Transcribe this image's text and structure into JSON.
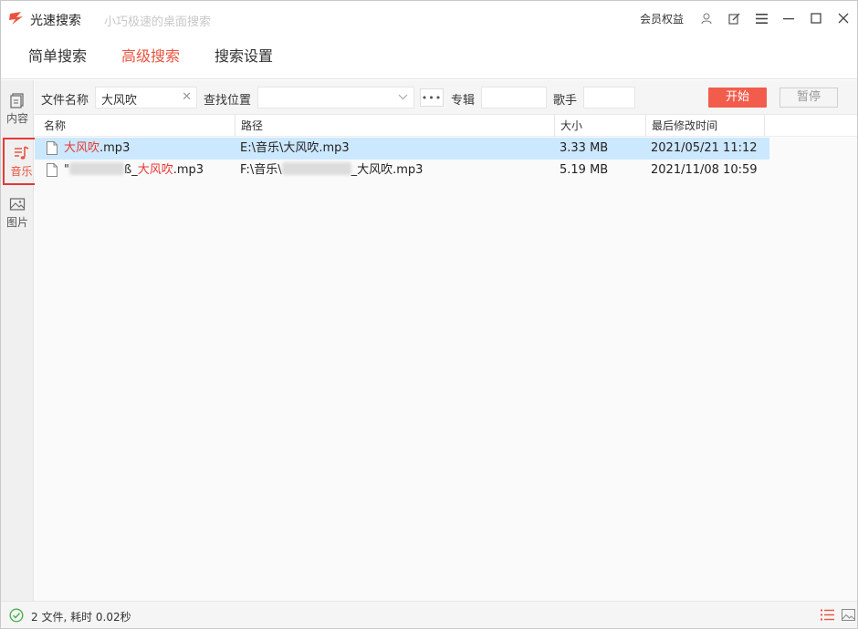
{
  "app": {
    "name": "光速搜索",
    "subtitle": "小巧极速的桌面搜索",
    "vip_label": "会员权益",
    "accent": "#e8533f"
  },
  "nav": {
    "tabs": [
      {
        "label": "简单搜索"
      },
      {
        "label": "高级搜索"
      },
      {
        "label": "搜索设置"
      }
    ],
    "active": "高级搜索"
  },
  "sidebar": {
    "items": [
      {
        "label": "内容"
      },
      {
        "label": "音乐"
      },
      {
        "label": "图片"
      }
    ],
    "active": "音乐"
  },
  "filter": {
    "filename_label": "文件名称",
    "filename_value": "大风吹",
    "location_label": "查找位置",
    "location_value": "",
    "album_label": "专辑",
    "album_value": "",
    "artist_label": "歌手",
    "artist_value": "",
    "start_label": "开始",
    "pause_label": "暂停"
  },
  "table": {
    "columns": [
      {
        "label": "名称"
      },
      {
        "label": "路径"
      },
      {
        "label": "大小"
      },
      {
        "label": "最后修改时间"
      }
    ],
    "rows": [
      {
        "name_match": "大风吹",
        "name_ext": ".mp3",
        "path": "E:\\音乐\\大风吹.mp3",
        "size": "3.33 MB",
        "modified": "2021/05/21 11:12",
        "selected": true
      },
      {
        "name_prefix_char": "\"",
        "name_suffix_char": "ß_",
        "name_match": "大风吹",
        "name_ext": ".mp3",
        "path_prefix": "F:\\音乐\\",
        "path_suffix": "_大风吹.mp3",
        "size": "5.19 MB",
        "modified": "2021/11/08 10:59",
        "selected": false
      }
    ]
  },
  "status": {
    "text": "2 文件, 耗时 0.02秒"
  }
}
